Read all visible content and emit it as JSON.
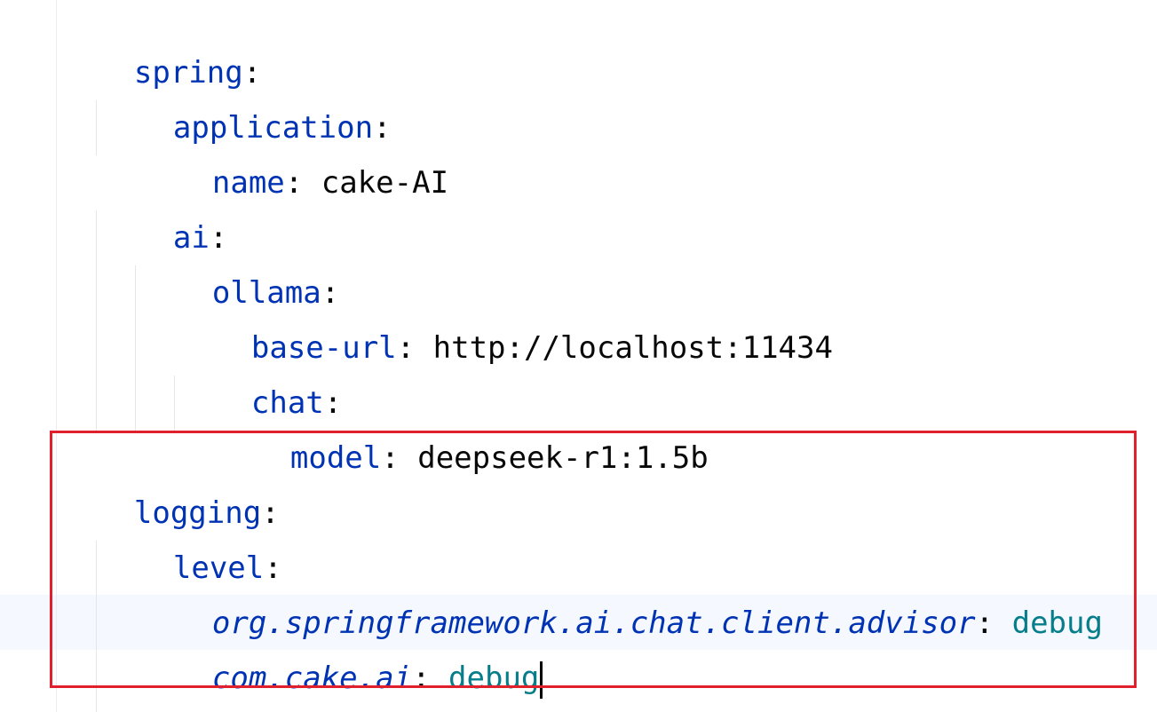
{
  "editor": {
    "lines": [
      {
        "key": "spring",
        "sep": ":",
        "value": ""
      },
      {
        "key": "application",
        "sep": ":",
        "value": ""
      },
      {
        "key": "name",
        "sep": ":",
        "value": "cake-AI"
      },
      {
        "key": "ai",
        "sep": ":",
        "value": ""
      },
      {
        "key": "ollama",
        "sep": ":",
        "value": ""
      },
      {
        "key": "base-url",
        "sep": ":",
        "value": "http://localhost:11434"
      },
      {
        "key": "chat",
        "sep": ":",
        "value": ""
      },
      {
        "key": "model",
        "sep": ":",
        "value": "deepseek-r1:1.5b"
      },
      {
        "key": "logging",
        "sep": ":",
        "value": ""
      },
      {
        "key": "level",
        "sep": ":",
        "value": ""
      },
      {
        "key": "org.springframework.ai.chat.client.advisor",
        "sep": ":",
        "value": "debug"
      },
      {
        "key": "com.cake.ai",
        "sep": ":",
        "value": "debug"
      }
    ]
  },
  "colors": {
    "key": "#0033b3",
    "plain_value": "#080808",
    "enum_value": "#067d8a",
    "highlight_border": "#e0202d",
    "current_line": "#f5f8fe"
  }
}
